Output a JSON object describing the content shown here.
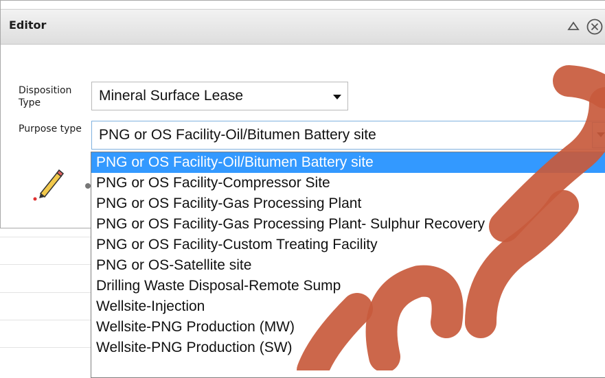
{
  "editor": {
    "title": "Editor",
    "disposition_label": "Disposition Type",
    "disposition_value": "Mineral Surface Lease",
    "purpose_label": "Purpose type",
    "purpose_value": "PNG or OS Facility-Oil/Bitumen Battery site"
  },
  "dropdown": {
    "options": [
      "PNG or OS Facility-Oil/Bitumen Battery site",
      "PNG or OS Facility-Compressor Site",
      "PNG or OS Facility-Gas Processing Plant",
      "PNG or OS Facility-Gas Processing Plant- Sulphur Recovery",
      "PNG or OS Facility-Custom Treating Facility",
      "PNG or OS-Satellite site",
      "Drilling Waste Disposal-Remote Sump",
      "Wellsite-Injection",
      "Wellsite-PNG Production (MW)",
      "Wellsite-PNG Production (SW)"
    ],
    "selected_index": 0
  },
  "colors": {
    "selection": "#3399ff",
    "watermark": "#c85a3c"
  },
  "icons": {
    "collapse": "collapse-icon",
    "close": "close-icon",
    "pencil": "pencil-icon"
  }
}
